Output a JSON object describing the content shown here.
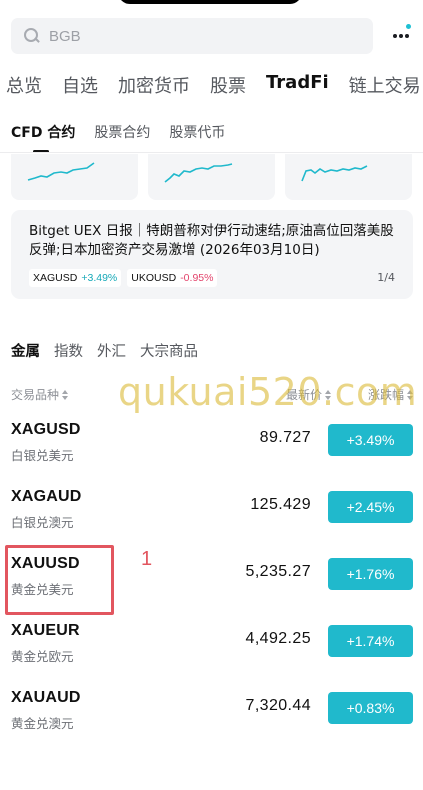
{
  "search": {
    "placeholder": "BGB"
  },
  "main_tabs": [
    "总览",
    "自选",
    "加密货币",
    "股票",
    "TradFi",
    "链上交易"
  ],
  "sub_tabs": [
    "CFD 合约",
    "股票合约",
    "股票代币"
  ],
  "report": {
    "text": "Bitget UEX 日报｜特朗普称对伊行动速结;原油高位回落美股反弹;日本加密资产交易激增 (2026年03月10日)",
    "chips": [
      {
        "symbol": "XAGUSD",
        "change": "+3.49%"
      },
      {
        "symbol": "UKOUSD",
        "change": "-0.95%"
      }
    ],
    "page": "1/4"
  },
  "category_tabs": [
    "金属",
    "指数",
    "外汇",
    "大宗商品"
  ],
  "table": {
    "col_symbol": "交易品种",
    "col_price": "最新价",
    "col_change": "涨跌幅"
  },
  "watermark": "qukuai520.com",
  "rows": [
    {
      "symbol": "XAGUSD",
      "desc": "白银兑美元",
      "price": "89.727",
      "change": "+3.49%"
    },
    {
      "symbol": "XAGAUD",
      "desc": "白银兑澳元",
      "price": "125.429",
      "change": "+2.45%"
    },
    {
      "symbol": "XAUUSD",
      "desc": "黄金兑美元",
      "price": "5,235.27",
      "change": "+1.76%"
    },
    {
      "symbol": "XAUEUR",
      "desc": "黄金兑欧元",
      "price": "4,492.25",
      "change": "+1.74%"
    },
    {
      "symbol": "XAUAUD",
      "desc": "黄金兑澳元",
      "price": "7,320.44",
      "change": "+0.83%"
    }
  ],
  "annotation": {
    "label": "1"
  },
  "colors": {
    "accent": "#20b9cc",
    "negative": "#e3436b",
    "annotation": "#e2565f"
  }
}
